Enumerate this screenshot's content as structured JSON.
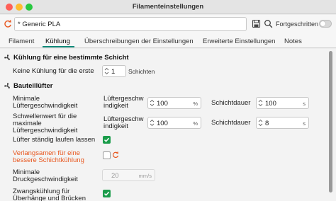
{
  "window": {
    "title": "Filamenteinstellungen"
  },
  "toolbar": {
    "preset_value": "* Generic PLA",
    "advanced_label": "Fortgeschritten",
    "advanced_enabled": false
  },
  "tabs": [
    {
      "label": "Filament",
      "active": false
    },
    {
      "label": "Kühlung",
      "active": true
    },
    {
      "label": "Überschreibungen der Einstellungen",
      "active": false
    },
    {
      "label": "Erweiterte Einstellungen",
      "active": false
    },
    {
      "label": "Notes",
      "active": false
    }
  ],
  "colors": {
    "accent": "#0a8b7a",
    "modified": "#e8571f",
    "checkbox_on": "#1a9c4a"
  },
  "section_cooling": {
    "heading": "Kühlung für eine bestimmte Schicht",
    "no_cooling_label": "Keine Kühlung für die erste",
    "no_cooling_value": "1",
    "no_cooling_unit": "Schichten"
  },
  "section_fan": {
    "heading": "Bauteillüfter",
    "min_fan_label": "Minimale Lüftergeschwindigkeit",
    "min_fan_speed_label": "Lüftergeschw indigkeit",
    "min_fan_speed_value": "100",
    "min_fan_speed_unit": "%",
    "min_fan_time_label": "Schichtdauer",
    "min_fan_time_value": "100",
    "min_fan_time_unit": "s",
    "max_fan_label": "Schwellenwert für die maximale Lüftergeschwindigkeit",
    "max_fan_speed_label": "Lüftergeschw indigkeit",
    "max_fan_speed_value": "100",
    "max_fan_speed_unit": "%",
    "max_fan_time_label": "Schichtdauer",
    "max_fan_time_value": "8",
    "max_fan_time_unit": "s",
    "always_on_label": "Lüfter ständig laufen lassen",
    "always_on_checked": true,
    "slowdown_label": "Verlangsamen für eine bessere Schichtkühlung",
    "slowdown_checked": false,
    "min_print_speed_label": "Minimale Druckgeschwindigkeit",
    "min_print_speed_value": "20",
    "min_print_speed_unit": "mm/s",
    "forced_cooling_label": "Zwangskühlung für Überhänge und Brücken",
    "forced_cooling_checked": true
  }
}
